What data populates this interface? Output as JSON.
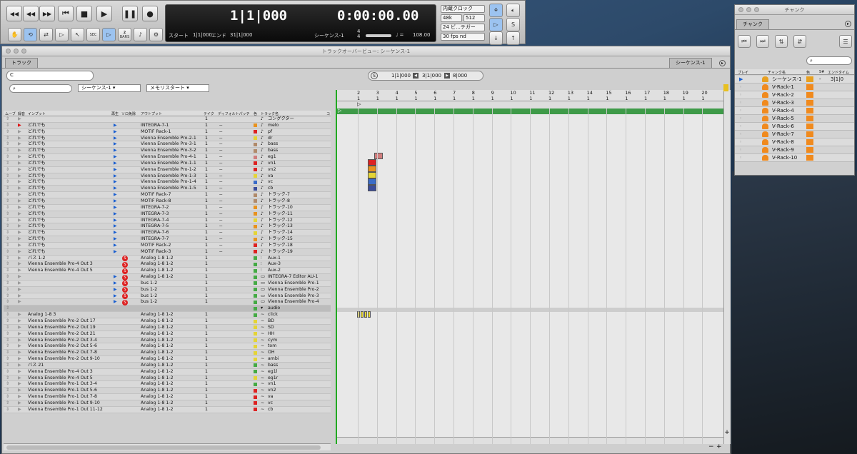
{
  "transport": {
    "counter_bars": "1|1|000",
    "counter_time": "0:00:00.00",
    "start_label": "スタート",
    "start_value": "1|1|000",
    "end_label": "エンド",
    "end_value": "31|1|000",
    "sequence": "シーケンス-1",
    "tempo_symbol": "♩ =",
    "tempo": "108.00",
    "sig_top": "4",
    "sig_bottom": "4",
    "clock": "内蔵クロック",
    "rate": "48k",
    "buffer": "512",
    "bitdepth": "24 ビ...テガー",
    "fps": "30 fps nd",
    "two_bars_top": "2",
    "two_bars_bottom": "BARS",
    "sec_label": "SEC",
    "s_label": "S"
  },
  "main": {
    "title": "トラックオーバービュー: シーケンス-1",
    "tab_tracks": "トラック",
    "tab_seq": "シーケンス-1",
    "c_btn": "C",
    "s_btn": "S",
    "seq_dropdown": "シーケンス-1",
    "marker_dropdown": "メモリスタート",
    "loc_start": "1|1|000",
    "loc_mid": "3|1|000",
    "loc_end": "8|000",
    "headers": {
      "move": "ムーブ",
      "rec": "録音",
      "input": "インプット",
      "play": "再生",
      "solo": "ソロ免除",
      "output": "アウトプット",
      "take": "テイク",
      "patch": "ディフォルトパッチ",
      "color": "色",
      "name": "トラック名",
      "c": "コ"
    }
  },
  "tracks": [
    {
      "input": "",
      "output": "",
      "take": "1",
      "patch": "",
      "color": "",
      "name": "コングクター",
      "type": "cond"
    },
    {
      "input": "どれでも",
      "output": "INTEGRA-7-1",
      "take": "1",
      "patch": "--",
      "color": "#e8921e",
      "name": "melo",
      "type": "midi",
      "rec": true,
      "play": true
    },
    {
      "input": "どれでも",
      "output": "MOTIF Rack-1",
      "take": "1",
      "patch": "--",
      "color": "#d22",
      "name": "pf",
      "type": "midi",
      "play": true
    },
    {
      "input": "どれでも",
      "output": "Vienna Ensemble Pro-2-1",
      "take": "1",
      "patch": "--",
      "color": "#e4d436",
      "name": "dr",
      "type": "midi",
      "play": true
    },
    {
      "input": "どれでも",
      "output": "Vienna Ensemble Pro-3-1",
      "take": "1",
      "patch": "--",
      "color": "#b08a6a",
      "name": "bass",
      "type": "midi",
      "play": true
    },
    {
      "input": "どれでも",
      "output": "Vienna Ensemble Pro-3-2",
      "take": "1",
      "patch": "--",
      "color": "#b08a6a",
      "name": "bass",
      "type": "midi",
      "play": true
    },
    {
      "input": "どれでも",
      "output": "Vienna Ensemble Pro-4-1",
      "take": "1",
      "patch": "--",
      "color": "#d07d7d",
      "name": "eg1",
      "type": "midi",
      "play": true
    },
    {
      "input": "どれでも",
      "output": "Vienna Ensemble Pro-1-1",
      "take": "1",
      "patch": "--",
      "color": "#d22",
      "name": "vn1",
      "type": "midi",
      "play": true
    },
    {
      "input": "どれでも",
      "output": "Vienna Ensemble Pro-1-2",
      "take": "1",
      "patch": "--",
      "color": "#d22",
      "name": "vn2",
      "type": "midi",
      "play": true
    },
    {
      "input": "どれでも",
      "output": "Vienna Ensemble Pro-1-3",
      "take": "1",
      "patch": "--",
      "color": "#e4d436",
      "name": "va",
      "type": "midi",
      "play": true
    },
    {
      "input": "どれでも",
      "output": "Vienna Ensemble Pro-1-4",
      "take": "1",
      "patch": "--",
      "color": "#3a6cc8",
      "name": "vc",
      "type": "midi",
      "play": true
    },
    {
      "input": "どれでも",
      "output": "Vienna Ensemble Pro-1-5",
      "take": "1",
      "patch": "--",
      "color": "#3a4c9a",
      "name": "cb",
      "type": "midi",
      "play": true
    },
    {
      "input": "どれでも",
      "output": "MOTIF Rack-7",
      "take": "1",
      "patch": "--",
      "color": "#b08a6a",
      "name": "トラック-7",
      "type": "midi",
      "play": true
    },
    {
      "input": "どれでも",
      "output": "MOTIF Rack-8",
      "take": "1",
      "patch": "--",
      "color": "#b08a6a",
      "name": "トラック-8",
      "type": "midi",
      "play": true
    },
    {
      "input": "どれでも",
      "output": "INTEGRA-7-2",
      "take": "1",
      "patch": "--",
      "color": "#e8921e",
      "name": "トラック-10",
      "type": "midi",
      "play": true
    },
    {
      "input": "どれでも",
      "output": "INTEGRA-7-3",
      "take": "1",
      "patch": "--",
      "color": "#e8921e",
      "name": "トラック-11",
      "type": "midi",
      "play": true
    },
    {
      "input": "どれでも",
      "output": "INTEGRA-7-4",
      "take": "1",
      "patch": "--",
      "color": "#e4d436",
      "name": "トラック-12",
      "type": "midi",
      "play": true
    },
    {
      "input": "どれでも",
      "output": "INTEGRA-7-5",
      "take": "1",
      "patch": "--",
      "color": "#e8921e",
      "name": "トラック-13",
      "type": "midi",
      "play": true
    },
    {
      "input": "どれでも",
      "output": "INTEGRA-7-6",
      "take": "1",
      "patch": "--",
      "color": "#e4d436",
      "name": "トラック-14",
      "type": "midi",
      "play": true
    },
    {
      "input": "どれでも",
      "output": "INTEGRA-7-7",
      "take": "1",
      "patch": "--",
      "color": "#e8921e",
      "name": "トラック-15",
      "type": "midi",
      "play": true
    },
    {
      "input": "どれでも",
      "output": "MOTIF Rack-2",
      "take": "1",
      "patch": "--",
      "color": "#d22",
      "name": "トラック-18",
      "type": "midi",
      "play": true
    },
    {
      "input": "どれでも",
      "output": "MOTIF Rack-3",
      "take": "1",
      "patch": "--",
      "color": "#d22",
      "name": "トラック-19",
      "type": "midi",
      "play": true
    },
    {
      "input": "バス 1-2",
      "output": "Analog 1-8 1-2",
      "take": "1",
      "patch": "",
      "color": "#4a4",
      "name": "Aux-1",
      "type": "aux",
      "solo": true
    },
    {
      "input": "Vienna Ensemble Pro-4 Out 3",
      "output": "Analog 1-8 1-2",
      "take": "1",
      "patch": "",
      "color": "#4a4",
      "name": "Aux-3",
      "type": "aux",
      "solo": true
    },
    {
      "input": "Vienna Ensemble Pro-4 Out 5",
      "output": "Analog 1-8 1-2",
      "take": "1",
      "patch": "",
      "color": "#4a4",
      "name": "Aux-2",
      "type": "aux",
      "solo": true
    },
    {
      "input": "",
      "output": "Analog 1-8 1-2",
      "take": "1",
      "patch": "",
      "color": "#4a4",
      "name": "INTEGRA-7 Editor AU-1",
      "type": "inst",
      "solo": true,
      "play": true
    },
    {
      "input": "",
      "output": "bus 1-2",
      "take": "1",
      "patch": "",
      "color": "#4a4",
      "name": "Vienna Ensemble Pro-1",
      "type": "inst",
      "solo": true,
      "play": true
    },
    {
      "input": "",
      "output": "bus 1-2",
      "take": "1",
      "patch": "",
      "color": "#4a4",
      "name": "Vienna Ensemble Pro-2",
      "type": "inst",
      "solo": true,
      "play": true
    },
    {
      "input": "",
      "output": "bus 1-2",
      "take": "1",
      "patch": "",
      "color": "#4a4",
      "name": "Vienna Ensemble Pro-3",
      "type": "inst",
      "solo": true,
      "play": true
    },
    {
      "input": "",
      "output": "bus 1-2",
      "take": "1",
      "patch": "",
      "color": "#4a4",
      "name": "Vienna Ensemble Pro-4",
      "type": "inst",
      "solo": true,
      "play": true
    },
    {
      "input": "",
      "output": "",
      "take": "",
      "patch": "",
      "color": "#4a4",
      "name": "audio",
      "type": "folder"
    },
    {
      "input": "Analog 1-8 3",
      "output": "Analog 1-8 1-2",
      "take": "1",
      "patch": "",
      "color": "#4a4",
      "name": "click",
      "type": "audio"
    },
    {
      "input": "Vienna Ensemble Pro-2 Out 17",
      "output": "Analog 1-8 1-2",
      "take": "1",
      "patch": "",
      "color": "#e4d436",
      "name": "BD",
      "type": "audio"
    },
    {
      "input": "Vienna Ensemble Pro-2 Out 19",
      "output": "Analog 1-8 1-2",
      "take": "1",
      "patch": "",
      "color": "#e4d436",
      "name": "SD",
      "type": "audio"
    },
    {
      "input": "Vienna Ensemble Pro-2 Out 21",
      "output": "Analog 1-8 1-2",
      "take": "1",
      "patch": "",
      "color": "#e4d436",
      "name": "HH",
      "type": "audio"
    },
    {
      "input": "Vienna Ensemble Pro-2 Out 3-4",
      "output": "Analog 1-8 1-2",
      "take": "1",
      "patch": "",
      "color": "#e4d436",
      "name": "cym",
      "type": "audio"
    },
    {
      "input": "Vienna Ensemble Pro-2 Out 5-6",
      "output": "Analog 1-8 1-2",
      "take": "1",
      "patch": "",
      "color": "#e4d436",
      "name": "tom",
      "type": "audio"
    },
    {
      "input": "Vienna Ensemble Pro-2 Out 7-8",
      "output": "Analog 1-8 1-2",
      "take": "1",
      "patch": "",
      "color": "#e4d436",
      "name": "OH",
      "type": "audio"
    },
    {
      "input": "Vienna Ensemble Pro-2 Out 9-10",
      "output": "Analog 1-8 1-2",
      "take": "1",
      "patch": "",
      "color": "#e4d436",
      "name": "ambi",
      "type": "audio"
    },
    {
      "input": "バス 21",
      "output": "Analog 1-8 1-2",
      "take": "1",
      "patch": "",
      "color": "#4a4",
      "name": "bass",
      "type": "audio"
    },
    {
      "input": "Vienna Ensemble Pro-4 Out 3",
      "output": "Analog 1-8 1-2",
      "take": "1",
      "patch": "",
      "color": "#4a4",
      "name": "eg1l",
      "type": "audio"
    },
    {
      "input": "Vienna Ensemble Pro-4 Out 5",
      "output": "Analog 1-8 1-2",
      "take": "1",
      "patch": "",
      "color": "#e4d436",
      "name": "eg1r",
      "type": "audio"
    },
    {
      "input": "Vienna Ensemble Pro-1 Out 3-4",
      "output": "Analog 1-8 1-2",
      "take": "1",
      "patch": "",
      "color": "#4a4",
      "name": "vn1",
      "type": "audio"
    },
    {
      "input": "Vienna Ensemble Pro-1 Out 5-6",
      "output": "Analog 1-8 1-2",
      "take": "1",
      "patch": "",
      "color": "#d22",
      "name": "vn2",
      "type": "audio"
    },
    {
      "input": "Vienna Ensemble Pro-1 Out 7-8",
      "output": "Analog 1-8 1-2",
      "take": "1",
      "patch": "",
      "color": "#d22",
      "name": "va",
      "type": "audio"
    },
    {
      "input": "Vienna Ensemble Pro-1 Out 9-10",
      "output": "Analog 1-8 1-2",
      "take": "1",
      "patch": "",
      "color": "#d22",
      "name": "vc",
      "type": "audio"
    },
    {
      "input": "Vienna Ensemble Pro-1 Out 11-12",
      "output": "Analog 1-8 1-2",
      "take": "1",
      "patch": "",
      "color": "#d22",
      "name": "cb",
      "type": "audio"
    }
  ],
  "ruler": [
    "2",
    "3",
    "4",
    "5",
    "6",
    "7",
    "8",
    "9",
    "10",
    "11",
    "12",
    "13",
    "14",
    "15",
    "16",
    "17",
    "18",
    "19",
    "20"
  ],
  "ruler_sub": "1",
  "chunk": {
    "title": "チャンク",
    "tab": "チャンク",
    "headers": {
      "play": "プレイ",
      "name": "チャンク名",
      "color": "色",
      "s": "S#",
      "end": "エンドタイム"
    },
    "items": [
      {
        "name": "シーケンス-1",
        "color": "#e8a020",
        "s": "-",
        "end": "3|1|0",
        "active": true
      },
      {
        "name": "V-Rack-1",
        "color": "#f08a1e"
      },
      {
        "name": "V-Rack-2",
        "color": "#f08a1e"
      },
      {
        "name": "V-Rack-3",
        "color": "#f08a1e"
      },
      {
        "name": "V-Rack-4",
        "color": "#f08a1e"
      },
      {
        "name": "V-Rack-5",
        "color": "#f08a1e"
      },
      {
        "name": "V-Rack-6",
        "color": "#f08a1e"
      },
      {
        "name": "V-Rack-7",
        "color": "#f08a1e"
      },
      {
        "name": "V-Rack-8",
        "color": "#f08a1e"
      },
      {
        "name": "V-Rack-9",
        "color": "#f08a1e"
      },
      {
        "name": "V-Rack-10",
        "color": "#f08a1e"
      }
    ]
  }
}
